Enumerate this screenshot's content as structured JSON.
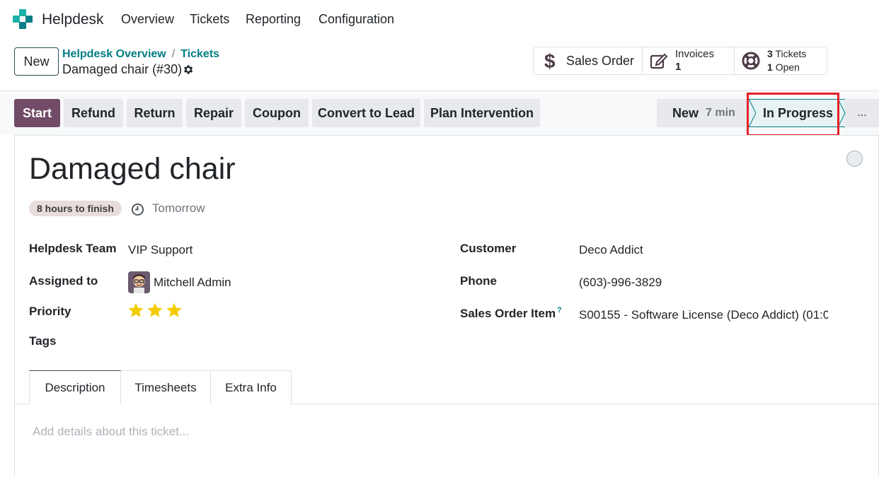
{
  "nav": {
    "app_name": "Helpdesk",
    "menu": [
      "Overview",
      "Tickets",
      "Reporting",
      "Configuration"
    ]
  },
  "control": {
    "new_label": "New",
    "breadcrumb": [
      "Helpdesk Overview",
      "Tickets"
    ],
    "breadcrumb_sep": "/",
    "record_name": "Damaged chair (#30)"
  },
  "smart_buttons": {
    "sales_order": "Sales Order",
    "invoices_label": "Invoices",
    "invoices_count": "1",
    "tickets_count": "3",
    "tickets_label": "Tickets",
    "open_count": "1",
    "open_label": "Open"
  },
  "actions": [
    "Start",
    "Refund",
    "Return",
    "Repair",
    "Coupon",
    "Convert to Lead",
    "Plan Intervention"
  ],
  "stages": {
    "new_label": "New",
    "new_duration": "7 min",
    "current": "In Progress",
    "more": "..."
  },
  "ticket": {
    "title": "Damaged chair",
    "sla": "8 hours to finish",
    "deadline": "Tomorrow",
    "fields": {
      "team_label": "Helpdesk Team",
      "team_value": "VIP Support",
      "assigned_label": "Assigned to",
      "assigned_value": "Mitchell Admin",
      "priority_label": "Priority",
      "priority_stars": 3,
      "tags_label": "Tags",
      "customer_label": "Customer",
      "customer_value": "Deco Addict",
      "phone_label": "Phone",
      "phone_value": "(603)-996-3829",
      "so_item_label": "Sales Order Item",
      "so_item_help": "?",
      "so_item_value": "S00155 - Software License (Deco Addict) (01:0"
    }
  },
  "tabs": [
    "Description",
    "Timesheets",
    "Extra Info"
  ],
  "description_placeholder": "Add details about this ticket...",
  "colors": {
    "primary": "#714b67",
    "link": "#017e84",
    "star": "#f3cc00",
    "highlight": "#e8202a"
  }
}
